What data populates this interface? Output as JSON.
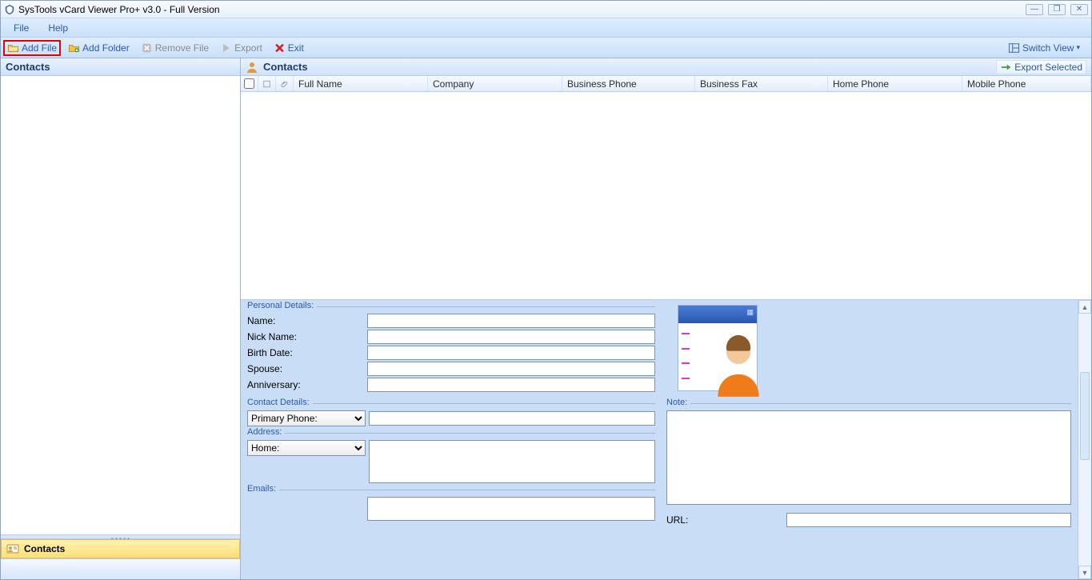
{
  "window": {
    "title": "SysTools vCard Viewer Pro+ v3.0 - Full Version"
  },
  "menubar": {
    "file": "File",
    "help": "Help"
  },
  "toolbar": {
    "add_file": "Add File",
    "add_folder": "Add Folder",
    "remove_file": "Remove File",
    "export": "Export",
    "exit": "Exit",
    "switch_view": "Switch View"
  },
  "left": {
    "header": "Contacts",
    "category": "Contacts"
  },
  "right": {
    "header": "Contacts",
    "export_selected": "Export Selected",
    "columns": {
      "fullname": "Full Name",
      "company": "Company",
      "bphone": "Business Phone",
      "bfax": "Business Fax",
      "hphone": "Home Phone",
      "mphone": "Mobile Phone"
    }
  },
  "details": {
    "personal_legend": "Personal Details:",
    "name": "Name:",
    "nickname": "Nick Name:",
    "birthdate": "Birth Date:",
    "spouse": "Spouse:",
    "anniversary": "Anniversary:",
    "contact_legend": "Contact Details:",
    "primary_phone_opt": "Primary Phone:",
    "address_legend": "Address:",
    "home_opt": "Home:",
    "emails_legend": "Emails:",
    "note_legend": "Note:",
    "url_label": "URL:"
  }
}
